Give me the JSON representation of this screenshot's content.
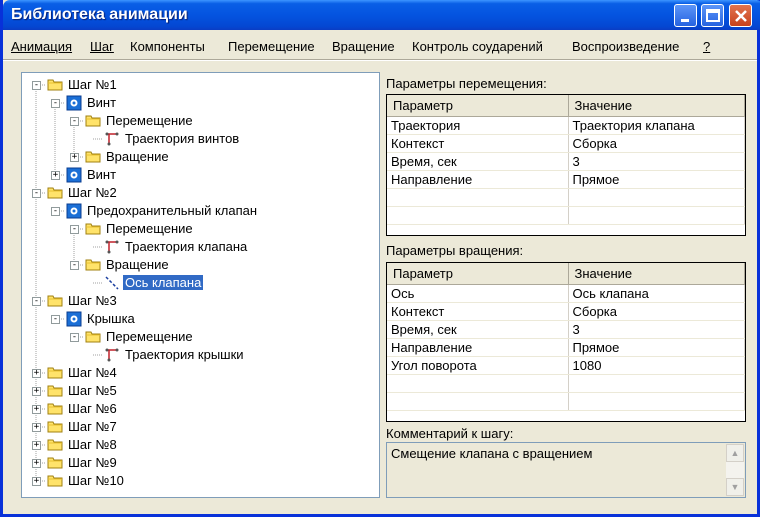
{
  "window": {
    "title": "Библиотека анимации"
  },
  "menu": [
    {
      "label": "Анимация",
      "key": "А"
    },
    {
      "label": "Шаг",
      "key": "Ш"
    },
    {
      "label": "Компоненты",
      "key": "К"
    },
    {
      "label": "Перемещение",
      "key": "П"
    },
    {
      "label": "Вращение",
      "key": "В"
    },
    {
      "label": "Контроль соударений",
      "key": "с"
    },
    {
      "label": "Воспроизведение",
      "key": "В"
    },
    {
      "label": "?",
      "key": "?"
    }
  ],
  "tree": [
    {
      "label": "Шаг №1",
      "icon": "folder-icon",
      "expander": "-"
    },
    {
      "label": "Винт",
      "icon": "component-icon",
      "expander": "-"
    },
    {
      "label": "Перемещение",
      "icon": "folder-icon",
      "expander": "-"
    },
    {
      "label": "Траектория винтов",
      "icon": "trajectory-icon",
      "expander": ""
    },
    {
      "label": "Вращение",
      "icon": "folder-icon",
      "expander": "+"
    },
    {
      "label": "Винт",
      "icon": "component-icon",
      "expander": "+"
    },
    {
      "label": "Шаг №2",
      "icon": "folder-icon",
      "expander": "-"
    },
    {
      "label": "Предохранительный клапан",
      "icon": "component-icon",
      "expander": "-"
    },
    {
      "label": "Перемещение",
      "icon": "folder-icon",
      "expander": "-"
    },
    {
      "label": "Траектория клапана",
      "icon": "trajectory-icon",
      "expander": ""
    },
    {
      "label": "Вращение",
      "icon": "folder-icon",
      "expander": "-"
    },
    {
      "label": "Ось клапана",
      "icon": "axis-icon",
      "expander": "",
      "selected": true
    },
    {
      "label": "Шаг №3",
      "icon": "folder-icon",
      "expander": "-"
    },
    {
      "label": "Крышка",
      "icon": "component-icon",
      "expander": "-"
    },
    {
      "label": "Перемещение",
      "icon": "folder-icon",
      "expander": "-"
    },
    {
      "label": "Траектория крышки",
      "icon": "trajectory-icon",
      "expander": ""
    },
    {
      "label": "Шаг №4",
      "icon": "folder-icon",
      "expander": "+"
    },
    {
      "label": "Шаг №5",
      "icon": "folder-icon",
      "expander": "+"
    },
    {
      "label": "Шаг №6",
      "icon": "folder-icon",
      "expander": "+"
    },
    {
      "label": "Шаг №7",
      "icon": "folder-icon",
      "expander": "+"
    },
    {
      "label": "Шаг №8",
      "icon": "folder-icon",
      "expander": "+"
    },
    {
      "label": "Шаг №9",
      "icon": "folder-icon",
      "expander": "+"
    },
    {
      "label": "Шаг №10",
      "icon": "folder-icon",
      "expander": "+"
    }
  ],
  "movement": {
    "title": "Параметры перемещения:",
    "col_param": "Параметр",
    "col_value": "Значение",
    "rows": [
      [
        "Траектория",
        "Траектория клапана"
      ],
      [
        "Контекст",
        "Сборка"
      ],
      [
        "Время, сек",
        "3"
      ],
      [
        "Направление",
        "Прямое"
      ],
      [
        "",
        ""
      ],
      [
        "",
        ""
      ]
    ]
  },
  "rotation": {
    "title": "Параметры вращения:",
    "col_param": "Параметр",
    "col_value": "Значение",
    "rows": [
      [
        "Ось",
        " Ось клапана"
      ],
      [
        "Контекст",
        "Сборка"
      ],
      [
        "Время, сек",
        "3"
      ],
      [
        "Направление",
        "Прямое"
      ],
      [
        "Угол поворота",
        "1080"
      ],
      [
        "",
        ""
      ],
      [
        "",
        ""
      ]
    ]
  },
  "comment": {
    "title": "Комментарий к шагу:",
    "text": "Смещение клапана с вращением"
  }
}
